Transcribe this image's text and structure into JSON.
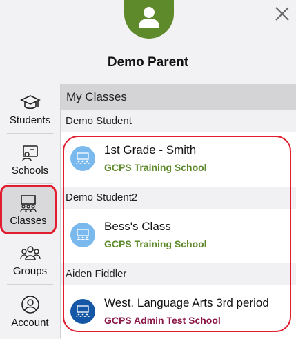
{
  "user": {
    "name": "Demo Parent",
    "avatar_icon": "person-icon",
    "avatar_color": "#5f8a2b"
  },
  "close_icon": "close-icon",
  "sidebar": {
    "items": [
      {
        "label": "Students",
        "icon": "graduation-cap-icon"
      },
      {
        "label": "Schools",
        "icon": "school-board-icon"
      },
      {
        "label": "Classes",
        "icon": "classroom-icon",
        "active": true
      },
      {
        "label": "Groups",
        "icon": "group-icon"
      },
      {
        "label": "Account",
        "icon": "account-icon"
      }
    ]
  },
  "main": {
    "title": "My Classes",
    "groups": [
      {
        "student": "Demo Student",
        "classes": [
          {
            "name": "1st Grade - Smith",
            "school": "GCPS Training School",
            "school_color": "#5f8a2b",
            "icon_color": "#79b9ee"
          }
        ]
      },
      {
        "student": "Demo Student2",
        "classes": [
          {
            "name": "Bess's Class",
            "school": "GCPS Training School",
            "school_color": "#5f8a2b",
            "icon_color": "#79b9ee"
          }
        ]
      },
      {
        "student": "Aiden Fiddler",
        "classes": [
          {
            "name": "West. Language Arts 3rd period",
            "school": "GCPS Admin Test School",
            "school_color": "#8b1748",
            "icon_color": "#1457a6"
          }
        ]
      }
    ]
  },
  "highlight_color": "#e21d2f"
}
